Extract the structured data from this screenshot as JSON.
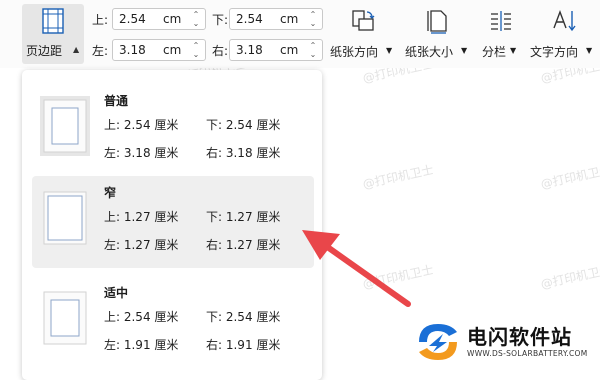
{
  "toolbar": {
    "page_margin_label": "页边距",
    "fields": {
      "top": {
        "label": "上:",
        "value": "2.54",
        "unit": "cm"
      },
      "bottom": {
        "label": "下:",
        "value": "2.54",
        "unit": "cm"
      },
      "left": {
        "label": "左:",
        "value": "3.18",
        "unit": "cm"
      },
      "right": {
        "label": "右:",
        "value": "3.18",
        "unit": "cm"
      }
    },
    "tools": [
      {
        "label": "纸张方向",
        "icon": "orientation-icon"
      },
      {
        "label": "纸张大小",
        "icon": "paper-size-icon"
      },
      {
        "label": "分栏",
        "icon": "columns-icon"
      },
      {
        "label": "文字方向",
        "icon": "text-direction-icon"
      }
    ]
  },
  "presets": [
    {
      "name": "普通",
      "top": "上: 2.54 厘米",
      "bottom": "下: 2.54 厘米",
      "left": "左: 3.18 厘米",
      "right": "右: 3.18 厘米"
    },
    {
      "name": "窄",
      "top": "上: 1.27 厘米",
      "bottom": "下: 1.27 厘米",
      "left": "左: 1.27 厘米",
      "right": "右: 1.27 厘米"
    },
    {
      "name": "适中",
      "top": "上: 2.54 厘米",
      "bottom": "下: 2.54 厘米",
      "left": "左: 1.91 厘米",
      "right": "右: 1.91 厘米"
    }
  ],
  "watermark": "@打印机卫士",
  "brand": {
    "name": "电闪软件站",
    "url": "WWW.DS-SOLARBATTERY.COM"
  },
  "colors": {
    "accent_arrow": "#e9464a",
    "logo_blue": "#1a6fd6",
    "logo_orange": "#f39a1e"
  }
}
